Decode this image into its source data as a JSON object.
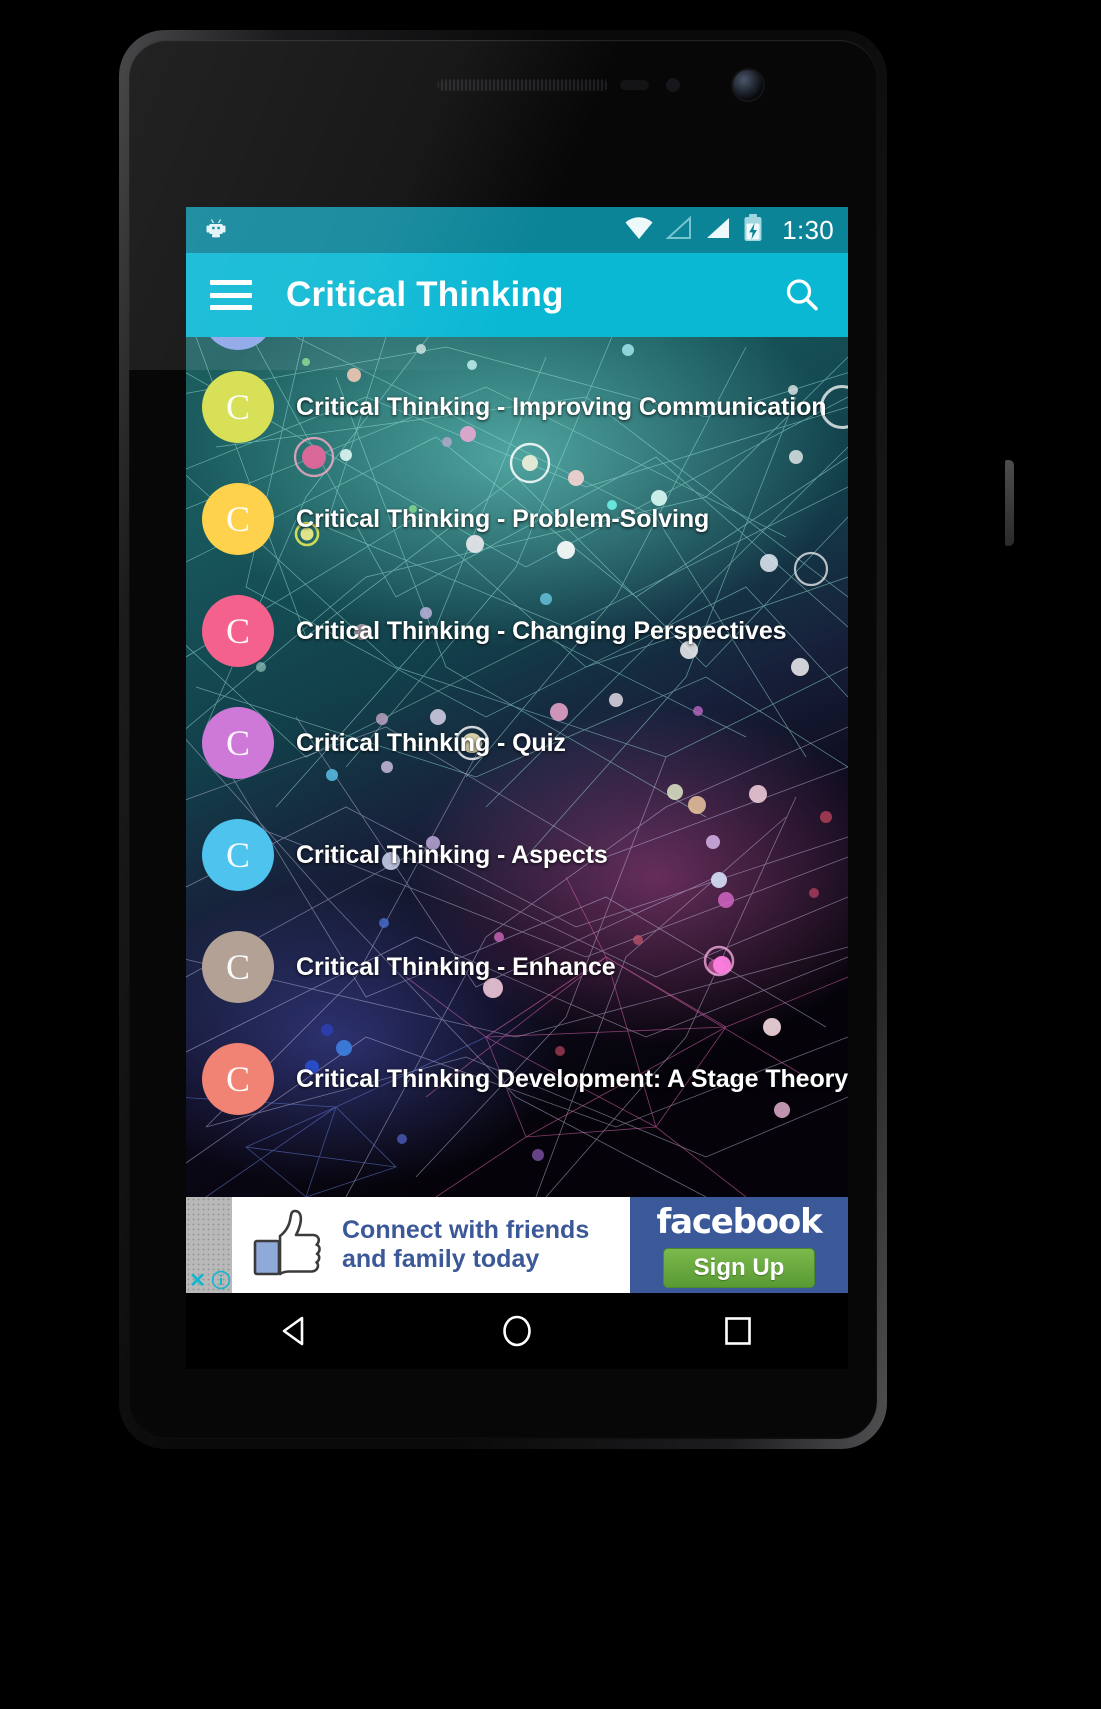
{
  "status_bar": {
    "time": "1:30",
    "icons": [
      "android-robot-icon",
      "wifi-icon",
      "signal-empty-icon",
      "signal-full-icon",
      "battery-charging-icon"
    ],
    "background_color": "#0b8498"
  },
  "app_bar": {
    "title": "Critical Thinking",
    "menu_icon": "hamburger-menu-icon",
    "search_icon": "search-icon",
    "background_color": "#0ab8d4",
    "text_color": "#ffffff"
  },
  "list": {
    "items": [
      {
        "label": "",
        "avatar_letter": "C",
        "avatar_color": "#8ca5e8",
        "partial": true
      },
      {
        "label": "Critical Thinking - Improving Communication",
        "avatar_letter": "C",
        "avatar_color": "#d8e057"
      },
      {
        "label": "Critical Thinking - Problem-Solving",
        "avatar_letter": "C",
        "avatar_color": "#ffd24d"
      },
      {
        "label": "Critical Thinking - Changing Perspectives",
        "avatar_letter": "C",
        "avatar_color": "#f4618c"
      },
      {
        "label": "Critical Thinking - Quiz",
        "avatar_letter": "C",
        "avatar_color": "#ce79d8"
      },
      {
        "label": "Critical Thinking - Aspects",
        "avatar_letter": "C",
        "avatar_color": "#4ec3ee"
      },
      {
        "label": "Critical Thinking - Enhance",
        "avatar_letter": "C",
        "avatar_color": "#b3a195"
      },
      {
        "label": "Critical Thinking Development: A Stage Theory",
        "avatar_letter": "C",
        "avatar_color": "#f08374"
      }
    ]
  },
  "ad": {
    "headline_line1": "Connect with friends",
    "headline_line2": "and family today",
    "brand": "facebook",
    "cta_label": "Sign Up",
    "close_label": "✕",
    "info_label": "i",
    "thumb_icon": "thumbs-up-icon",
    "brand_color": "#3b5998",
    "cta_color": "#6db043"
  },
  "nav_bar": {
    "back_icon": "back-triangle-icon",
    "home_icon": "home-circle-icon",
    "recents_icon": "recents-square-icon"
  }
}
